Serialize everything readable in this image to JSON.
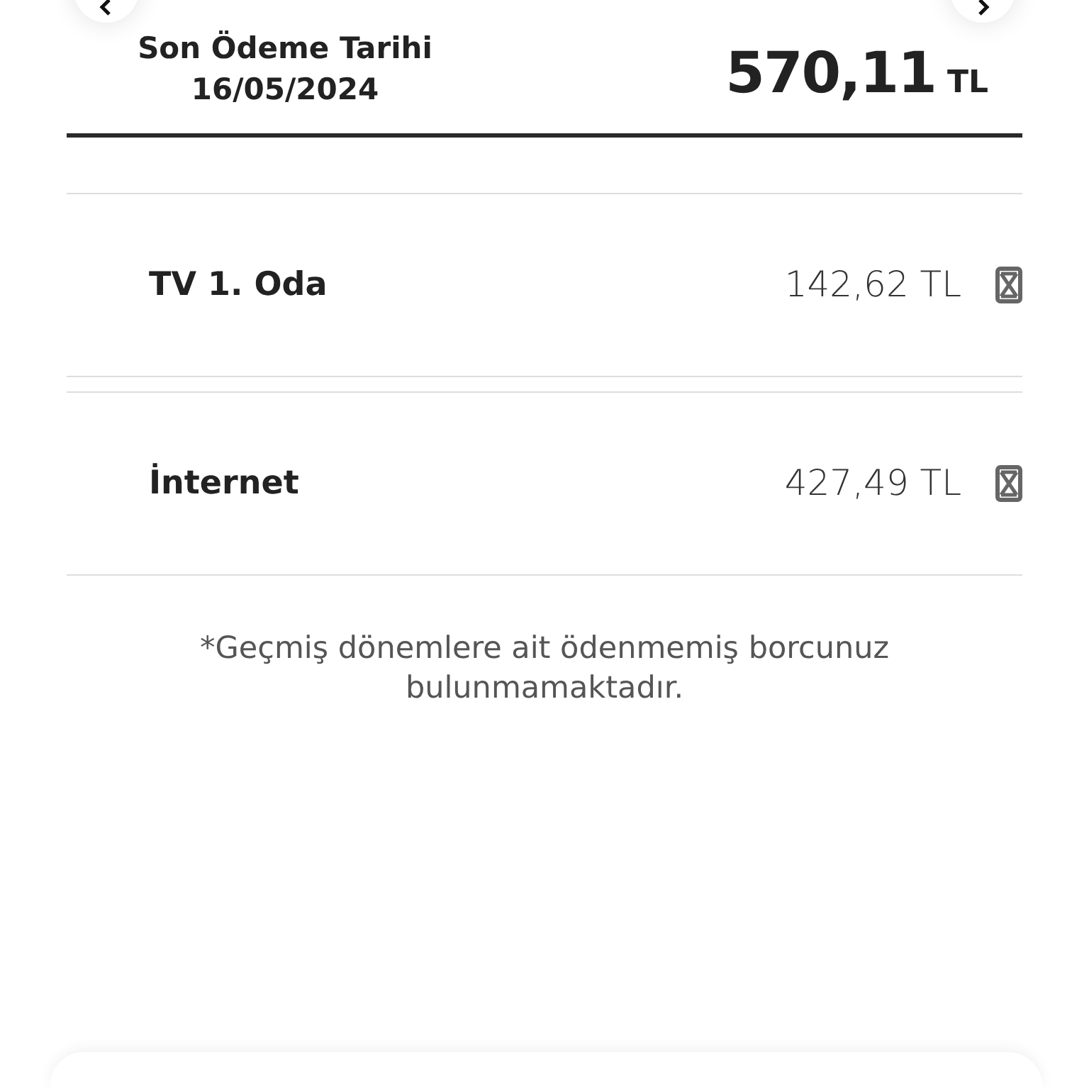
{
  "header": {
    "label": "Son Ödeme Tarihi",
    "date": "16/05/2024",
    "amount": "570,11",
    "currency": "TL"
  },
  "items": [
    {
      "name": "TV 1. Oda",
      "amount": "142,62 TL"
    },
    {
      "name": "İnternet",
      "amount": "427,49 TL"
    }
  ],
  "footnote": "*Geçmiş dönemlere ait ödenmemiş borcunuz bulunmamaktadır."
}
